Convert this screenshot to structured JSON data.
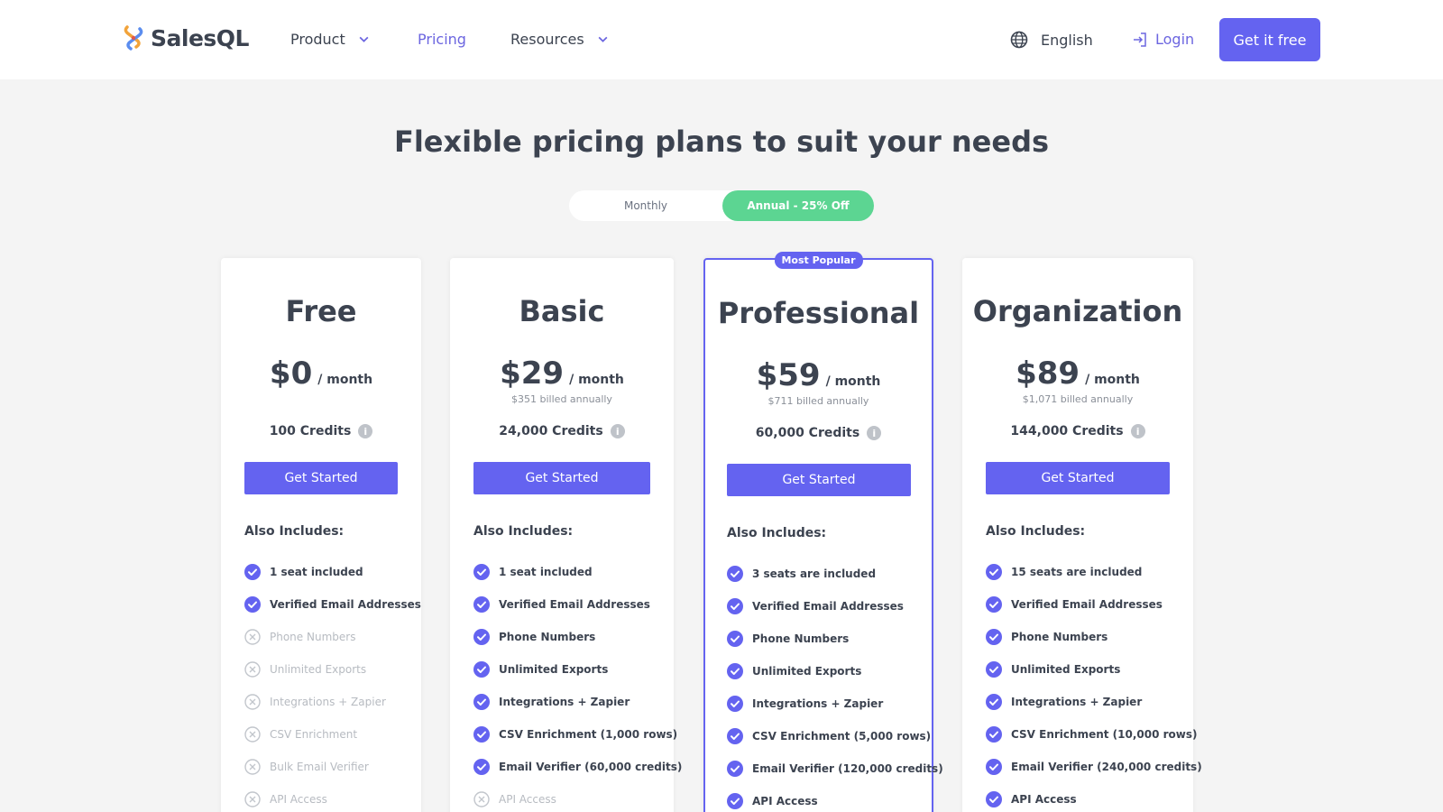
{
  "brand": {
    "name": "SalesQL"
  },
  "nav": {
    "product": "Product",
    "pricing": "Pricing",
    "resources": "Resources",
    "language": "English",
    "login": "Login",
    "cta": "Get it free"
  },
  "page": {
    "title": "Flexible pricing plans to suit your needs"
  },
  "billing_toggle": {
    "monthly": "Monthly",
    "annual": "Annual - 25% Off",
    "selected": "annual"
  },
  "colors": {
    "accent": "#6463f0",
    "toggle_active": "#5cd592",
    "text": "#3c4350",
    "muted": "#b7bbc1"
  },
  "plans": [
    {
      "name": "Free",
      "price": "$0",
      "per": "/ month",
      "billed": "",
      "credits": "100 Credits",
      "button": "Get Started",
      "includes_label": "Also Includes:",
      "features": [
        {
          "label": "1 seat included",
          "included": true
        },
        {
          "label": "Verified Email Addresses",
          "included": true
        },
        {
          "label": "Phone Numbers",
          "included": false
        },
        {
          "label": "Unlimited Exports",
          "included": false
        },
        {
          "label": "Integrations + Zapier",
          "included": false
        },
        {
          "label": "CSV Enrichment",
          "included": false
        },
        {
          "label": "Bulk Email Verifier",
          "included": false
        },
        {
          "label": "API Access",
          "included": false
        }
      ]
    },
    {
      "name": "Basic",
      "price": "$29",
      "per": "/ month",
      "billed": "$351 billed annually",
      "credits": "24,000 Credits",
      "button": "Get Started",
      "includes_label": "Also Includes:",
      "features": [
        {
          "label": "1 seat included",
          "included": true
        },
        {
          "label": "Verified Email Addresses",
          "included": true
        },
        {
          "label": "Phone Numbers",
          "included": true
        },
        {
          "label": "Unlimited Exports",
          "included": true
        },
        {
          "label": "Integrations + Zapier",
          "included": true
        },
        {
          "label": "CSV Enrichment (1,000 rows)",
          "included": true
        },
        {
          "label": "Email Verifier (60,000 credits)",
          "included": true
        },
        {
          "label": "API Access",
          "included": false
        }
      ]
    },
    {
      "name": "Professional",
      "badge": "Most Popular",
      "price": "$59",
      "per": "/ month",
      "billed": "$711 billed annually",
      "credits": "60,000 Credits",
      "button": "Get Started",
      "includes_label": "Also Includes:",
      "features": [
        {
          "label": "3 seats are included",
          "included": true
        },
        {
          "label": "Verified Email Addresses",
          "included": true
        },
        {
          "label": "Phone Numbers",
          "included": true
        },
        {
          "label": "Unlimited Exports",
          "included": true
        },
        {
          "label": "Integrations + Zapier",
          "included": true
        },
        {
          "label": "CSV Enrichment (5,000 rows)",
          "included": true
        },
        {
          "label": "Email Verifier (120,000 credits)",
          "included": true
        },
        {
          "label": "API Access",
          "included": true
        }
      ]
    },
    {
      "name": "Organization",
      "price": "$89",
      "per": "/ month",
      "billed": "$1,071 billed annually",
      "credits": "144,000 Credits",
      "button": "Get Started",
      "includes_label": "Also Includes:",
      "features": [
        {
          "label": "15 seats are included",
          "included": true
        },
        {
          "label": "Verified Email Addresses",
          "included": true
        },
        {
          "label": "Phone Numbers",
          "included": true
        },
        {
          "label": "Unlimited Exports",
          "included": true
        },
        {
          "label": "Integrations + Zapier",
          "included": true
        },
        {
          "label": "CSV Enrichment (10,000 rows)",
          "included": true
        },
        {
          "label": "Email Verifier (240,000 credits)",
          "included": true
        },
        {
          "label": "API Access",
          "included": true
        }
      ]
    }
  ]
}
